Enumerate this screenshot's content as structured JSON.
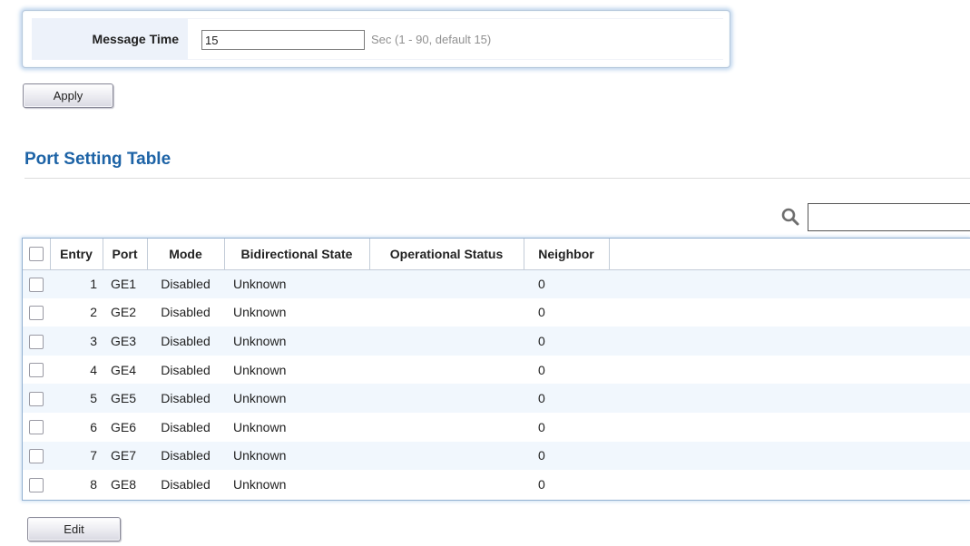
{
  "message_time": {
    "label": "Message Time",
    "value": "15",
    "hint": "Sec (1 - 90, default 15)"
  },
  "apply_label": "Apply",
  "section": {
    "title": "Port Setting Table"
  },
  "search": {
    "value": "",
    "icon": "search-icon"
  },
  "table": {
    "headers": {
      "entry": "Entry",
      "port": "Port",
      "mode": "Mode",
      "bidirectional_state": "Bidirectional State",
      "operational_status": "Operational Status",
      "neighbor": "Neighbor"
    },
    "rows": [
      {
        "entry": "1",
        "port": "GE1",
        "mode": "Disabled",
        "bidirectional_state": "Unknown",
        "operational_status": "",
        "neighbor": "0",
        "checked": false
      },
      {
        "entry": "2",
        "port": "GE2",
        "mode": "Disabled",
        "bidirectional_state": "Unknown",
        "operational_status": "",
        "neighbor": "0",
        "checked": false
      },
      {
        "entry": "3",
        "port": "GE3",
        "mode": "Disabled",
        "bidirectional_state": "Unknown",
        "operational_status": "",
        "neighbor": "0",
        "checked": false
      },
      {
        "entry": "4",
        "port": "GE4",
        "mode": "Disabled",
        "bidirectional_state": "Unknown",
        "operational_status": "",
        "neighbor": "0",
        "checked": false
      },
      {
        "entry": "5",
        "port": "GE5",
        "mode": "Disabled",
        "bidirectional_state": "Unknown",
        "operational_status": "",
        "neighbor": "0",
        "checked": false
      },
      {
        "entry": "6",
        "port": "GE6",
        "mode": "Disabled",
        "bidirectional_state": "Unknown",
        "operational_status": "",
        "neighbor": "0",
        "checked": false
      },
      {
        "entry": "7",
        "port": "GE7",
        "mode": "Disabled",
        "bidirectional_state": "Unknown",
        "operational_status": "",
        "neighbor": "0",
        "checked": false
      },
      {
        "entry": "8",
        "port": "GE8",
        "mode": "Disabled",
        "bidirectional_state": "Unknown",
        "operational_status": "",
        "neighbor": "0",
        "checked": false
      }
    ]
  },
  "edit_label": "Edit",
  "colors": {
    "title_blue": "#1d63a6",
    "row_stripe": "#f1f7fd",
    "panel_glow": "#bcd3ec"
  }
}
